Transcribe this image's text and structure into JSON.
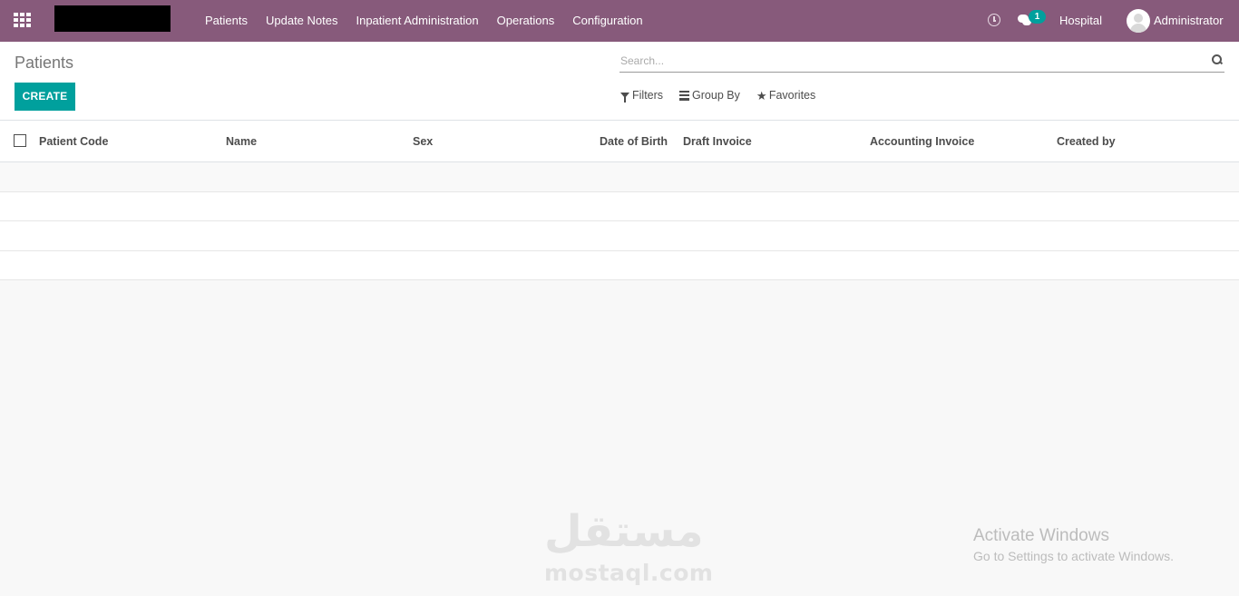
{
  "navbar": {
    "menu": [
      "Patients",
      "Update Notes",
      "Inpatient Administration",
      "Operations",
      "Configuration"
    ],
    "message_count": "1",
    "company": "Hospital",
    "user": "Administrator",
    "accent_color": "#875a7b"
  },
  "control_panel": {
    "title": "Patients",
    "create_label": "CREATE",
    "search_placeholder": "Search...",
    "filters_label": "Filters",
    "group_by_label": "Group By",
    "favorites_label": "Favorites",
    "primary_color": "#00a09d"
  },
  "list": {
    "columns": [
      "Patient Code",
      "Name",
      "Sex",
      "Date of Birth",
      "Draft Invoice",
      "Accounting Invoice",
      "Created by"
    ],
    "rows": []
  },
  "overlay": {
    "watermark_arabic": "مستقل",
    "watermark_url": "mostaql.com",
    "activate_title": "Activate Windows",
    "activate_subtitle": "Go to Settings to activate Windows."
  }
}
